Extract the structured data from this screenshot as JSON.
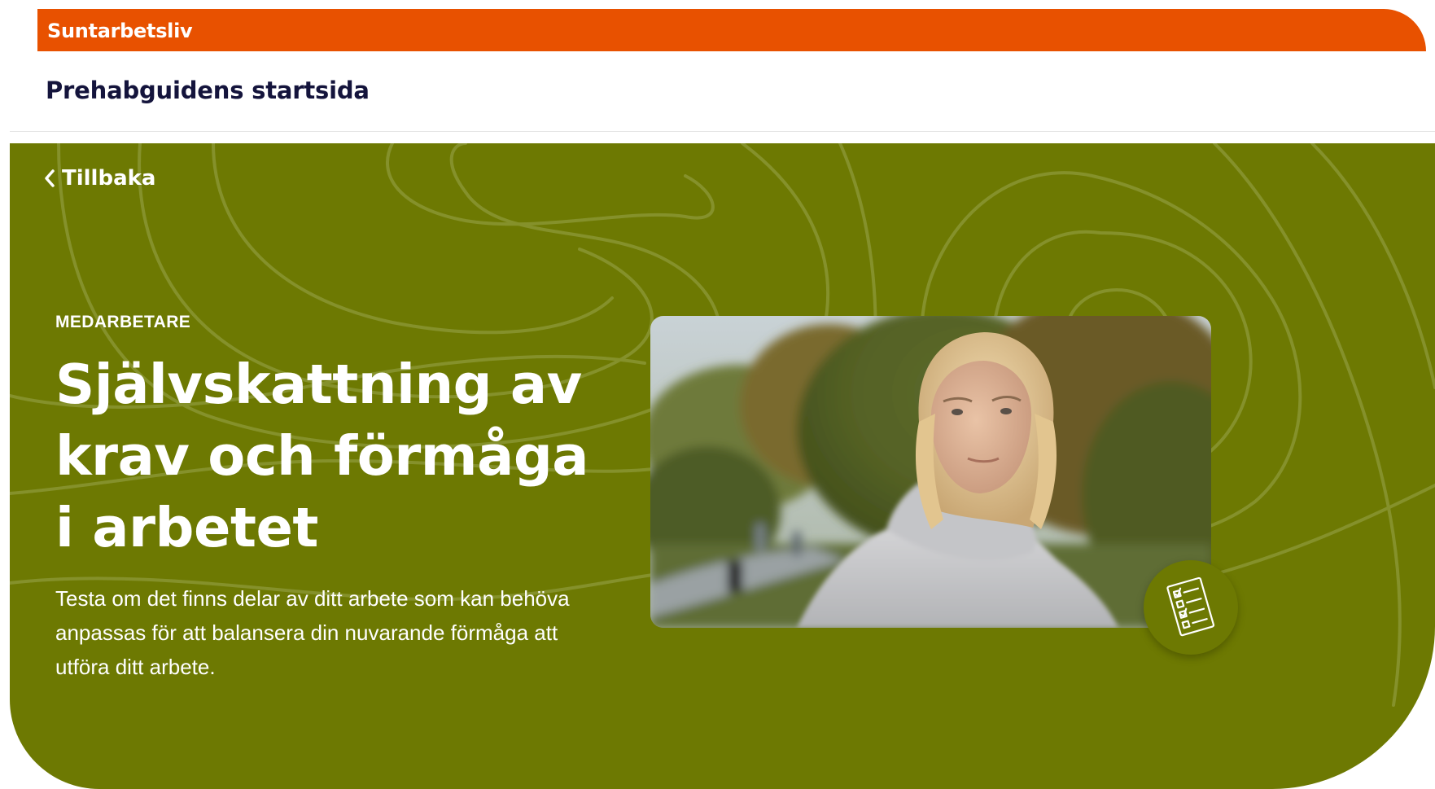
{
  "brand": {
    "name": "Suntarbetsliv",
    "color": "#e85100"
  },
  "header": {
    "title": "Prehabguidens startsida"
  },
  "hero": {
    "background_color": "#6d7902",
    "back_label": "Tillbaka",
    "eyebrow": "MEDARBETARE",
    "heading": "Självskattning av krav och förmåga i arbetet",
    "lead": "Testa om det finns delar av ditt arbete som kan behöva anpassas för att balansera din nuvarande förmåga att utföra ditt arbete.",
    "image": {
      "kind": "photo",
      "subject": "woman-in-grey-hoodie-in-park"
    },
    "badge_icon": "checklist-icon"
  }
}
